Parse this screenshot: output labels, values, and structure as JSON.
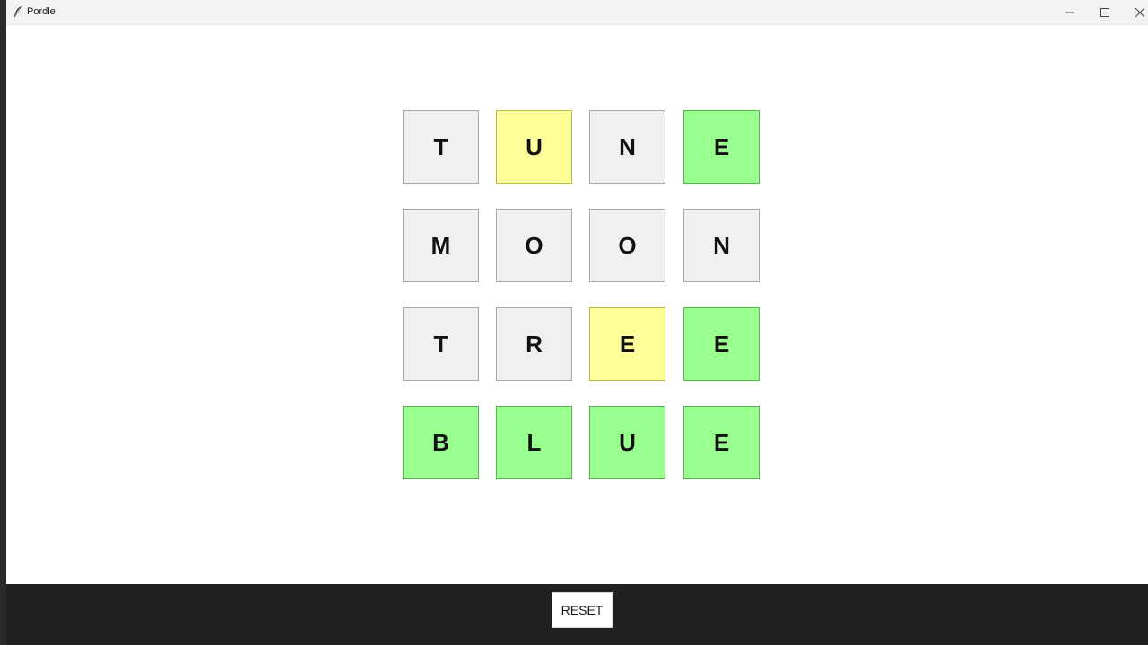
{
  "window": {
    "title": "Pordle"
  },
  "board": {
    "rows": [
      [
        {
          "letter": "T",
          "state": "absent"
        },
        {
          "letter": "U",
          "state": "present"
        },
        {
          "letter": "N",
          "state": "absent"
        },
        {
          "letter": "E",
          "state": "correct"
        }
      ],
      [
        {
          "letter": "M",
          "state": "absent"
        },
        {
          "letter": "O",
          "state": "absent"
        },
        {
          "letter": "O",
          "state": "absent"
        },
        {
          "letter": "N",
          "state": "absent"
        }
      ],
      [
        {
          "letter": "T",
          "state": "absent"
        },
        {
          "letter": "R",
          "state": "absent"
        },
        {
          "letter": "E",
          "state": "present"
        },
        {
          "letter": "E",
          "state": "correct"
        }
      ],
      [
        {
          "letter": "B",
          "state": "correct"
        },
        {
          "letter": "L",
          "state": "correct"
        },
        {
          "letter": "U",
          "state": "correct"
        },
        {
          "letter": "E",
          "state": "correct"
        }
      ]
    ]
  },
  "footer": {
    "reset_label": "RESET"
  },
  "colors": {
    "absent": "#f0f0f0",
    "present": "#ffff99",
    "correct": "#99ff8f",
    "footer_bg": "#212121"
  }
}
